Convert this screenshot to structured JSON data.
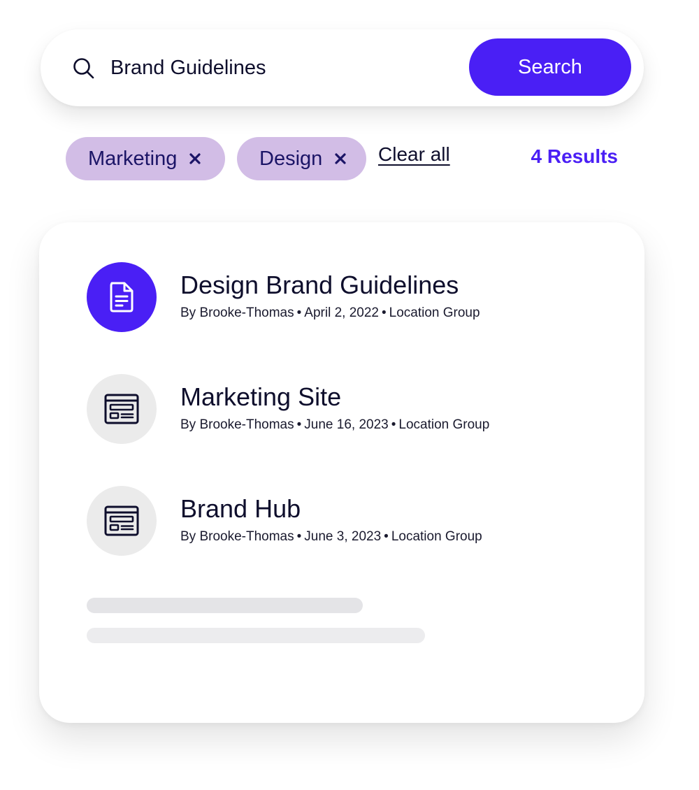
{
  "search": {
    "value": "Brand Guidelines",
    "button_label": "Search"
  },
  "filters": {
    "chips": [
      {
        "label": "Marketing"
      },
      {
        "label": "Design"
      }
    ],
    "clear_label": "Clear all",
    "results_count": "4 Results"
  },
  "results": [
    {
      "title": "Design Brand Guidelines",
      "author": "By Brooke-Thomas",
      "date": "April 2, 2022",
      "location": "Location Group",
      "icon": "document-icon"
    },
    {
      "title": "Marketing Site",
      "author": "By Brooke-Thomas",
      "date": "June 16, 2023",
      "location": "Location Group",
      "icon": "webpage-icon"
    },
    {
      "title": "Brand Hub",
      "author": "By Brooke-Thomas",
      "date": "June 3, 2023",
      "location": "Location Group",
      "icon": "webpage-icon"
    }
  ],
  "colors": {
    "accent": "#4a1ff5",
    "chip_bg": "#d2bde6",
    "chip_text": "#1b1466",
    "icon_neutral_bg": "#ebebeb",
    "skeleton": "#e4e4e7"
  }
}
